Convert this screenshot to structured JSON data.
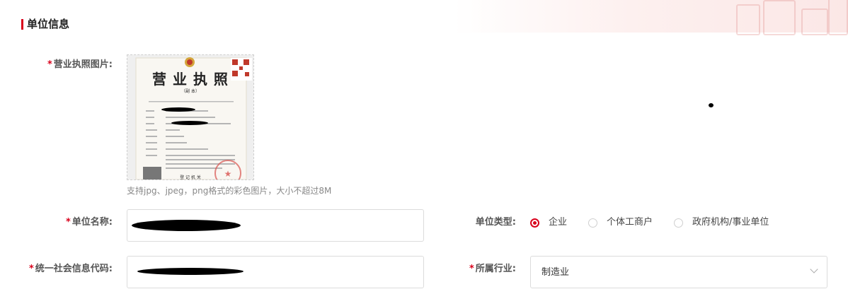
{
  "section": {
    "title": "单位信息"
  },
  "license": {
    "label": "营业执照图片:",
    "required_mark": "*",
    "image": {
      "heading": "营 业 执 照",
      "copy_label": "（副 本）",
      "bottom_text": "登 记 机 关"
    },
    "hint": "支持jpg、jpeg，png格式的彩色图片，大小不超过8M"
  },
  "company_name": {
    "label": "单位名称:",
    "required_mark": "*",
    "value": ""
  },
  "credit_code": {
    "label": "统一社会信息代码:",
    "required_mark": "*",
    "value": ""
  },
  "unit_type": {
    "label": "单位类型:",
    "options": [
      {
        "label": "企业",
        "selected": true
      },
      {
        "label": "个体工商户",
        "selected": false
      },
      {
        "label": "政府机构/事业单位",
        "selected": false
      }
    ]
  },
  "industry": {
    "label": "所属行业:",
    "required_mark": "*",
    "value": "制造业"
  },
  "colors": {
    "accent": "#d9001b"
  }
}
